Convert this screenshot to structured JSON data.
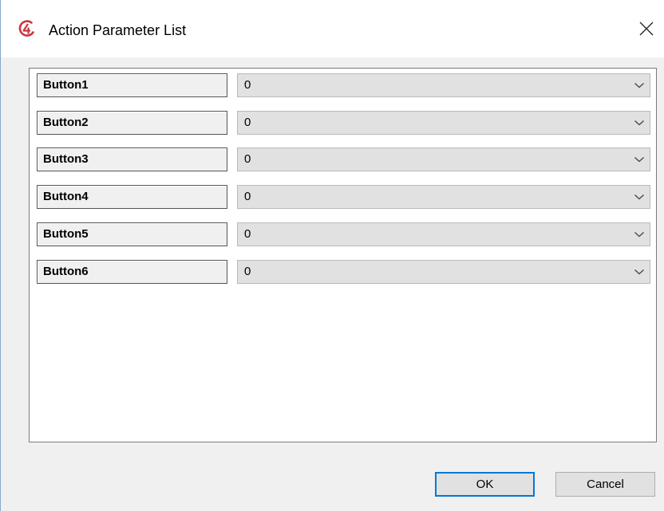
{
  "window": {
    "title": "Action Parameter List",
    "app_icon": "c4d-app-icon",
    "close_icon": "close-icon"
  },
  "parameters": [
    {
      "label": "Button1",
      "value": "0"
    },
    {
      "label": "Button2",
      "value": "0"
    },
    {
      "label": "Button3",
      "value": "0"
    },
    {
      "label": "Button4",
      "value": "0"
    },
    {
      "label": "Button5",
      "value": "0"
    },
    {
      "label": "Button6",
      "value": "0"
    }
  ],
  "buttons": {
    "ok": "OK",
    "cancel": "Cancel"
  },
  "colors": {
    "accent": "#0078d7",
    "app_icon": "#c8383f"
  }
}
